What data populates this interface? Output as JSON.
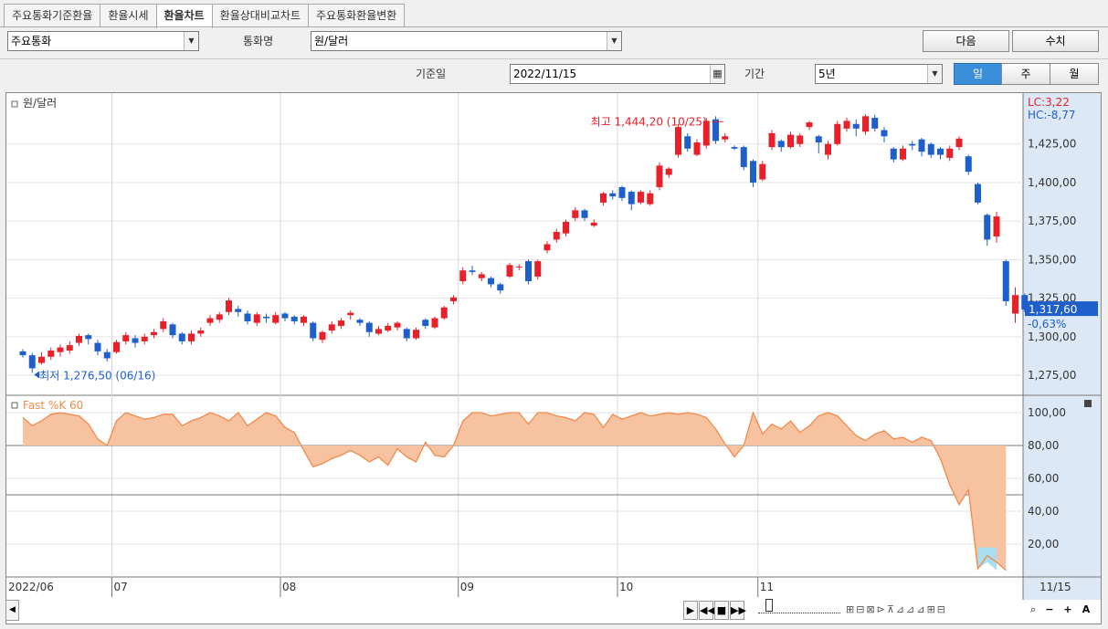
{
  "tabs": [
    "주요통화기준환율",
    "환율시세",
    "환율차트",
    "환율상대비교차트",
    "주요통화환율변환"
  ],
  "active_tab": 2,
  "controls": {
    "currency_group": "주요통화",
    "currency_name_label": "통화명",
    "currency_name": "원/달러",
    "next_button": "다음",
    "value_button": "수치",
    "base_date_label": "기준일",
    "base_date": "2022/11/15",
    "period_label": "기간",
    "period": "5년",
    "interval_buttons": [
      "일",
      "주",
      "월"
    ],
    "interval_active": 0
  },
  "chart_data": [
    {
      "type": "candlestick",
      "title": "원/달러",
      "ylim": [
        1262,
        1458
      ],
      "yticks": [
        "1,425,00",
        "1,400,00",
        "1,375,00",
        "1,350,00",
        "1,325,00",
        "1,300,00",
        "1,275,00"
      ],
      "ytick_values": [
        1425,
        1400,
        1375,
        1350,
        1325,
        1300,
        1275
      ],
      "x_labels": [
        "2022/06",
        "07",
        "08",
        "09",
        "10",
        "11",
        "11/15"
      ],
      "x_label_index": [
        0,
        10,
        28,
        47,
        64,
        79,
        93
      ],
      "lc_label": "LC:3,22",
      "hc_label": "HC:-8,77",
      "max_annotation": "최고 1,444,20 (10/25)",
      "max_index": 75,
      "max_value": 1444.2,
      "min_annotation": "최저 1,276,50 (06/16)",
      "min_index": 1,
      "min_value": 1276.5,
      "last_price": "1,317,60",
      "last_value": 1317.6,
      "change_pct": "-0,63%",
      "candles": [
        [
          1290.5,
          1288,
          1292,
          1286.5
        ],
        [
          1288,
          1279.5,
          1289.5,
          1276.5
        ],
        [
          1283,
          1287,
          1290,
          1282
        ],
        [
          1287,
          1291,
          1293,
          1285
        ],
        [
          1290,
          1293,
          1295,
          1287
        ],
        [
          1291,
          1294.5,
          1297,
          1289
        ],
        [
          1296,
          1300.5,
          1302,
          1294
        ],
        [
          1301,
          1298.5,
          1302,
          1295
        ],
        [
          1296,
          1290.5,
          1298,
          1288
        ],
        [
          1290,
          1286,
          1292,
          1284
        ],
        [
          1290,
          1296.5,
          1298,
          1289
        ],
        [
          1297,
          1301,
          1303,
          1295
        ],
        [
          1299,
          1296,
          1301,
          1293
        ],
        [
          1297,
          1300,
          1302,
          1295
        ],
        [
          1301,
          1303,
          1305,
          1299
        ],
        [
          1305,
          1310,
          1312,
          1303
        ],
        [
          1308,
          1301,
          1309,
          1299
        ],
        [
          1302,
          1297,
          1303,
          1295
        ],
        [
          1297,
          1302,
          1304,
          1295
        ],
        [
          1302,
          1304,
          1306,
          1300
        ],
        [
          1309,
          1312,
          1314,
          1307
        ],
        [
          1311,
          1314.5,
          1316,
          1309
        ],
        [
          1316,
          1323.5,
          1325,
          1314
        ],
        [
          1318,
          1316,
          1320,
          1313
        ],
        [
          1315,
          1310,
          1317,
          1308
        ],
        [
          1309,
          1314.5,
          1316,
          1307
        ],
        [
          1313,
          1312,
          1315,
          1309
        ],
        [
          1309,
          1314,
          1316,
          1308
        ],
        [
          1315,
          1312,
          1316,
          1310
        ],
        [
          1313,
          1310,
          1314,
          1308
        ],
        [
          1309,
          1313,
          1314,
          1307
        ],
        [
          1309,
          1299,
          1310,
          1297
        ],
        [
          1298,
          1303,
          1304,
          1296
        ],
        [
          1304,
          1308,
          1310,
          1302
        ],
        [
          1307,
          1310.5,
          1312,
          1305
        ],
        [
          1314,
          1315.5,
          1317,
          1311
        ],
        [
          1311,
          1309,
          1312,
          1307
        ],
        [
          1309,
          1303,
          1310,
          1300
        ],
        [
          1302,
          1305,
          1307,
          1301
        ],
        [
          1304,
          1307,
          1309,
          1303
        ],
        [
          1306,
          1309,
          1310,
          1304
        ],
        [
          1305,
          1299,
          1306,
          1297
        ],
        [
          1299,
          1304.5,
          1306,
          1298
        ],
        [
          1311,
          1307,
          1312,
          1305
        ],
        [
          1306,
          1312,
          1313,
          1305
        ],
        [
          1312,
          1319,
          1320,
          1311
        ],
        [
          1323,
          1325.5,
          1327,
          1321
        ],
        [
          1336,
          1343,
          1345,
          1334
        ],
        [
          1343,
          1342,
          1346,
          1340
        ],
        [
          1338,
          1340.5,
          1342,
          1336
        ],
        [
          1338,
          1334,
          1339,
          1332
        ],
        [
          1334,
          1330,
          1335,
          1328
        ],
        [
          1339,
          1346.5,
          1348,
          1338
        ],
        [
          1345,
          1345.5,
          1347,
          1343
        ],
        [
          1349,
          1336,
          1350,
          1334
        ],
        [
          1339,
          1349,
          1350,
          1337
        ],
        [
          1356,
          1360,
          1362,
          1354
        ],
        [
          1363,
          1368,
          1370,
          1361
        ],
        [
          1367,
          1374.5,
          1376,
          1365
        ],
        [
          1377,
          1382,
          1384,
          1375
        ],
        [
          1382,
          1377,
          1383,
          1375
        ],
        [
          1372,
          1374,
          1376,
          1371
        ],
        [
          1387,
          1393,
          1394,
          1385
        ],
        [
          1393,
          1391,
          1395,
          1389
        ],
        [
          1397,
          1390,
          1398,
          1388
        ],
        [
          1394,
          1386,
          1395,
          1382
        ],
        [
          1387,
          1394,
          1395,
          1386
        ],
        [
          1386,
          1393,
          1395,
          1385
        ],
        [
          1397,
          1411,
          1413,
          1395
        ],
        [
          1405,
          1409,
          1410,
          1403
        ],
        [
          1418,
          1436,
          1438,
          1416
        ],
        [
          1430,
          1422,
          1432,
          1420
        ],
        [
          1418,
          1426,
          1428,
          1417
        ],
        [
          1424,
          1440,
          1442,
          1422
        ],
        [
          1441,
          1427,
          1443,
          1425
        ],
        [
          1428,
          1430,
          1432,
          1426
        ],
        [
          1423,
          1422,
          1424,
          1421
        ],
        [
          1423,
          1410,
          1424,
          1408
        ],
        [
          1414,
          1400,
          1415,
          1397
        ],
        [
          1402,
          1412,
          1414,
          1401
        ],
        [
          1423,
          1432,
          1434,
          1421
        ],
        [
          1427,
          1423,
          1428,
          1420
        ],
        [
          1423,
          1431,
          1433,
          1422
        ],
        [
          1425,
          1430.5,
          1432,
          1423
        ],
        [
          1436,
          1439,
          1440,
          1434
        ],
        [
          1430,
          1426,
          1431,
          1419
        ],
        [
          1418,
          1425,
          1427,
          1415
        ],
        [
          1425,
          1438,
          1440,
          1424
        ],
        [
          1435,
          1440,
          1442,
          1433
        ],
        [
          1438,
          1435,
          1441,
          1430
        ],
        [
          1433,
          1443,
          1444.2,
          1431
        ],
        [
          1442,
          1435,
          1444,
          1433
        ],
        [
          1434,
          1430,
          1436,
          1426
        ],
        [
          1422,
          1415,
          1423,
          1413
        ],
        [
          1415,
          1422,
          1424,
          1414
        ],
        [
          1425,
          1424,
          1427,
          1421
        ],
        [
          1428,
          1420,
          1429,
          1417
        ],
        [
          1425,
          1418,
          1426,
          1416
        ],
        [
          1422,
          1418,
          1423,
          1415
        ],
        [
          1416,
          1422,
          1424,
          1414
        ],
        [
          1423,
          1428.5,
          1430,
          1421
        ],
        [
          1417,
          1407,
          1418,
          1405
        ],
        [
          1399,
          1387,
          1400,
          1386
        ],
        [
          1379,
          1363,
          1380,
          1359
        ],
        [
          1365,
          1378,
          1381,
          1361
        ],
        [
          1349,
          1323,
          1350,
          1320
        ],
        [
          1315,
          1327,
          1332,
          1309
        ],
        [
          1327,
          1317.6,
          1328,
          1316
        ]
      ]
    },
    {
      "type": "area",
      "title": "Fast %K 60",
      "ylim": [
        0,
        110
      ],
      "yticks": [
        "100,00",
        "80,00",
        "60,00",
        "40,00",
        "20,00"
      ],
      "ytick_values": [
        100,
        80,
        60,
        40,
        20
      ],
      "levels": [
        80,
        50
      ],
      "values": [
        97,
        92,
        95,
        99,
        100,
        99,
        98,
        93,
        84,
        80,
        95,
        100,
        98,
        96,
        97,
        99,
        99,
        92,
        95,
        97,
        100,
        98,
        95,
        100,
        92,
        96,
        100,
        98,
        91,
        88,
        77,
        67,
        69,
        72,
        74,
        77,
        74,
        70,
        73,
        68,
        78,
        73,
        70,
        82,
        74,
        73,
        80,
        95,
        100,
        100,
        98,
        99,
        100,
        100,
        93,
        100,
        100,
        98,
        97,
        95,
        100,
        99,
        91,
        99,
        96,
        98,
        100,
        98,
        99,
        100,
        99,
        100,
        99,
        97,
        90,
        81,
        73,
        80,
        100,
        87,
        93,
        90,
        95,
        88,
        92,
        98,
        100,
        98,
        92,
        86,
        83,
        87,
        89,
        84,
        85,
        82,
        85,
        83,
        72,
        56,
        44,
        53,
        5,
        13,
        9,
        4
      ]
    }
  ],
  "bottom_toolbar": {
    "scroll_left_icon": "scroll-left-icon",
    "nav_icons": [
      "play-icon",
      "rewind-icon",
      "stop-icon",
      "fast-forward-icon"
    ],
    "zoom_icons": [
      "zoom-in-icon",
      "zoom-out-icon",
      "plus-icon",
      "text-icon"
    ]
  },
  "colors": {
    "up": "#e8202a",
    "down": "#1f5fcc",
    "fastk": "#f08a4b",
    "accent": "#3b8fd9"
  }
}
